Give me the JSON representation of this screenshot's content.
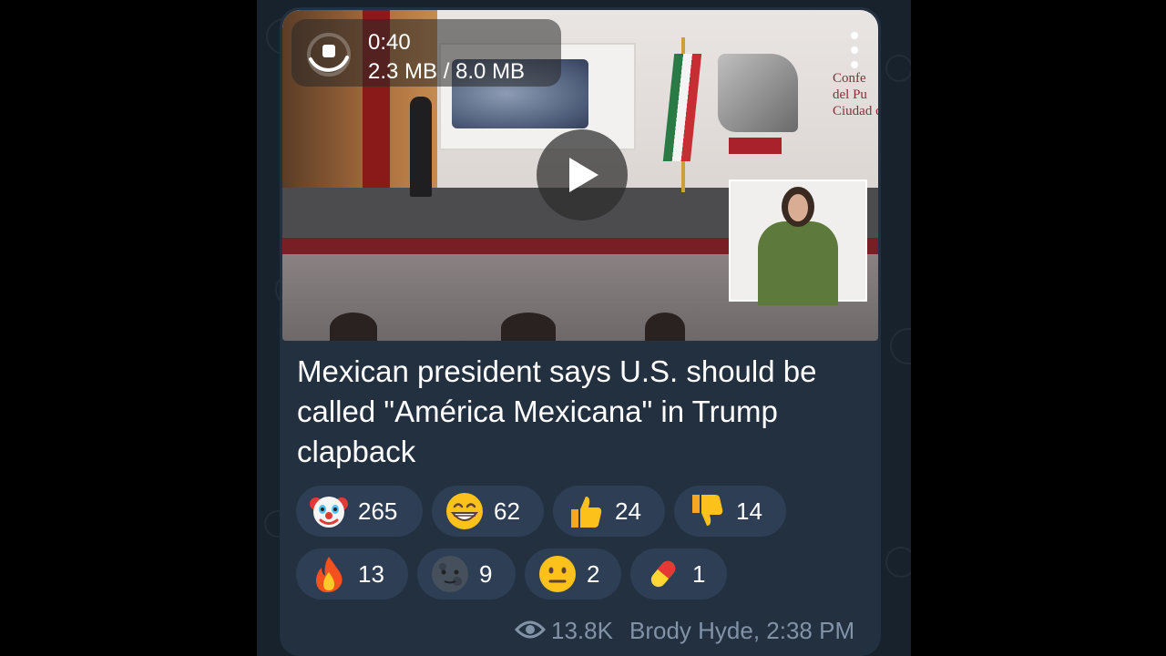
{
  "video": {
    "duration": "0:40",
    "download_progress": "2.3 MB / 8.0 MB",
    "background_sign": "Confe\ndel Pu\nCiudad d",
    "icons": {
      "download": "stop-download-icon",
      "menu": "more-vertical-icon",
      "play": "play-icon"
    }
  },
  "message": {
    "caption": "Mexican president says U.S. should be called \"América Mexicana\" in Trump clapback"
  },
  "reactions": [
    {
      "emoji": "clown-face",
      "count": "265"
    },
    {
      "emoji": "grinning-face",
      "count": "62"
    },
    {
      "emoji": "thumbs-up",
      "count": "24"
    },
    {
      "emoji": "thumbs-down",
      "count": "14"
    },
    {
      "emoji": "fire",
      "count": "13"
    },
    {
      "emoji": "new-moon-face",
      "count": "9"
    },
    {
      "emoji": "neutral-face",
      "count": "2"
    },
    {
      "emoji": "pill",
      "count": "1"
    }
  ],
  "meta": {
    "views": "13.8K",
    "author_time": "Brody Hyde, 2:38 PM",
    "icon": "eye-icon"
  },
  "colors": {
    "chat_background": "#18222d",
    "bubble": "#233040",
    "reaction_pill": "#2e3f55",
    "meta_text": "#8293a7"
  }
}
